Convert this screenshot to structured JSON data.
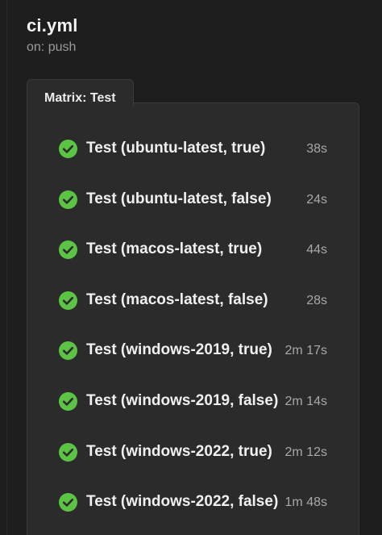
{
  "workflow": {
    "title": "ci.yml",
    "trigger": "on: push"
  },
  "matrix": {
    "tab_label": "Matrix: Test"
  },
  "status_color": "#5cc445",
  "jobs": [
    {
      "name": "Test (ubuntu-latest, true)",
      "duration": "38s",
      "status": "success",
      "icon": "check-circle-icon"
    },
    {
      "name": "Test (ubuntu-latest, false)",
      "duration": "24s",
      "status": "success",
      "icon": "check-circle-icon"
    },
    {
      "name": "Test (macos-latest, true)",
      "duration": "44s",
      "status": "success",
      "icon": "check-circle-icon"
    },
    {
      "name": "Test (macos-latest, false)",
      "duration": "28s",
      "status": "success",
      "icon": "check-circle-icon"
    },
    {
      "name": "Test (windows-2019, true)",
      "duration": "2m 17s",
      "status": "success",
      "icon": "check-circle-icon"
    },
    {
      "name": "Test (windows-2019, false)",
      "duration": "2m 14s",
      "status": "success",
      "icon": "check-circle-icon"
    },
    {
      "name": "Test (windows-2022, true)",
      "duration": "2m 12s",
      "status": "success",
      "icon": "check-circle-icon"
    },
    {
      "name": "Test (windows-2022, false)",
      "duration": "1m 48s",
      "status": "success",
      "icon": "check-circle-icon"
    }
  ]
}
